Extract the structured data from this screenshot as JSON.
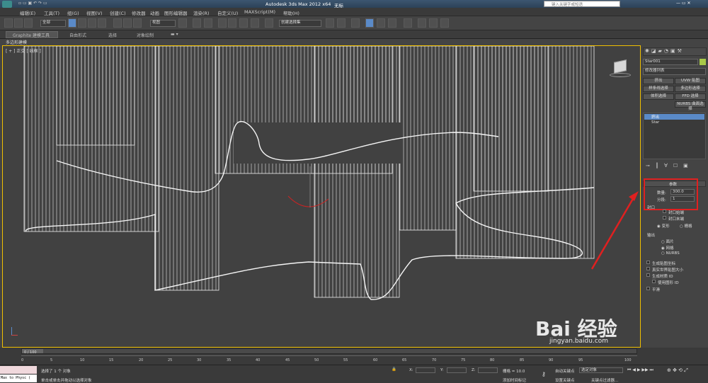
{
  "title": {
    "app": "Autodesk 3ds Max  2012 x64",
    "doc": "无标",
    "search_placeholder": "键入关键字或短语"
  },
  "menu": [
    "编辑(E)",
    "工具(T)",
    "组(G)",
    "视图(V)",
    "创建(C)",
    "修改器",
    "动画",
    "图形编辑器",
    "渲染(R)",
    "自定义(U)",
    "MAXScript(M)",
    "帮助(H)"
  ],
  "toolbar": {
    "selection_filter": "全部",
    "ref_coord": "视图",
    "named_sel": "创建选择集"
  },
  "ribbon": {
    "tabs": [
      "Graphite 建模工具",
      "自由形式",
      "选择",
      "对象绘制"
    ]
  },
  "sub_label": "多边形建模",
  "viewport": {
    "label": "[ + ] 正交 [ 线框 ]"
  },
  "cmd": {
    "object_name": "Star001",
    "modifier_list": "修改器列表",
    "buttons": [
      "挤出",
      "UVW 贴图",
      "样条线选择",
      "多边形选择",
      "体积选择",
      "FFD 选择",
      "NURBS 曲面选择"
    ],
    "stack": [
      "挤出",
      "Star"
    ],
    "rollout": "参数",
    "amount_label": "数量:",
    "amount_value": "300.0",
    "segments_label": "分段:",
    "segments_value": "1",
    "cap_group": "封口",
    "cap_start": "封口始端",
    "cap_end": "封口末端",
    "morph": "变形",
    "grid": "栅格",
    "output_group": "输出",
    "out_patch": "面片",
    "out_mesh": "网格",
    "out_nurbs": "NURBS",
    "gen_map": "生成贴图坐标",
    "real_world": "真实世界贴图大小",
    "gen_mat": "生成材质 ID",
    "use_shape": "使用图形 ID",
    "smooth": "平滑"
  },
  "timeline": {
    "slider": "0 / 100",
    "ticks": [
      "0",
      "5",
      "10",
      "15",
      "20",
      "25",
      "30",
      "35",
      "40",
      "45",
      "50",
      "55",
      "60",
      "65",
      "70",
      "75",
      "80",
      "85",
      "90",
      "95",
      "100"
    ]
  },
  "status": {
    "script": "Max to Physc ( ",
    "selected": "选择了 1 个 对象",
    "hint": "单击或单击并拖动以选择对象",
    "x": "X:",
    "y": "Y:",
    "z": "Z:",
    "grid": "栅格 = 10.0",
    "autokey": "自动关键点",
    "setkey": "设置关键点",
    "key_mode": "选定对象",
    "add_time": "添加时间标记",
    "key_filter": "关键点过滤器..."
  },
  "watermark": {
    "brand": "Bai 经验",
    "url": "jingyan.baidu.com"
  }
}
